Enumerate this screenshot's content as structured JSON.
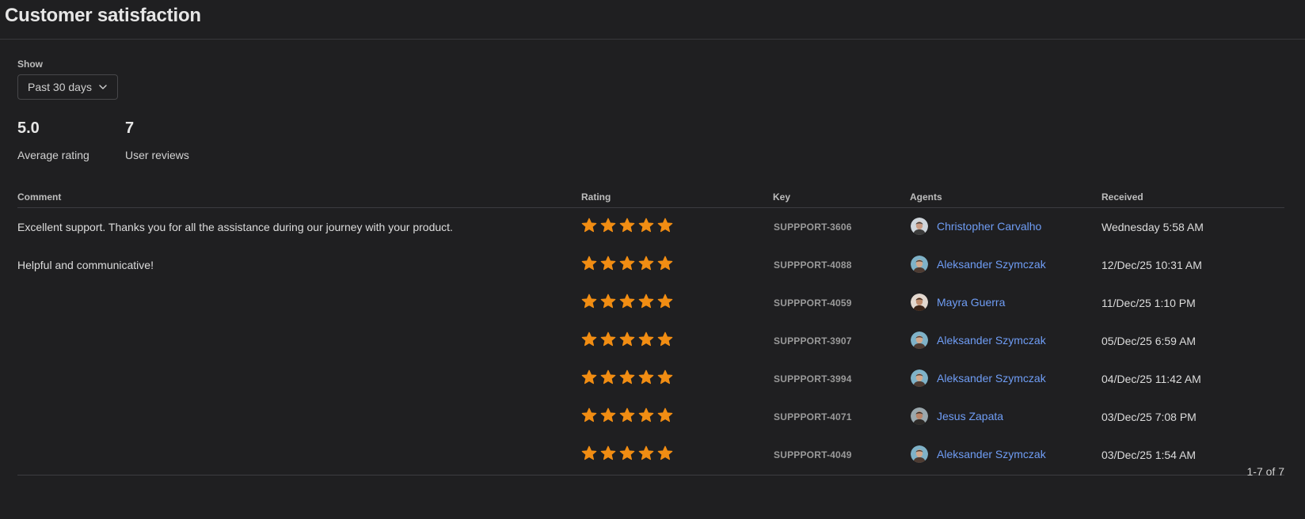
{
  "header": {
    "title": "Customer satisfaction"
  },
  "filter": {
    "label": "Show",
    "selected": "Past 30 days"
  },
  "metrics": {
    "average": {
      "value": "5.0",
      "label": "Average rating"
    },
    "reviews": {
      "value": "7",
      "label": "User reviews"
    }
  },
  "table": {
    "columns": [
      "Comment",
      "Rating",
      "Key",
      "Agents",
      "Received"
    ],
    "rows": [
      {
        "comment": "Excellent support. Thanks you for all the assistance during our journey with your product.",
        "rating": 5,
        "key": "SUPPPORT-3606",
        "agent": "Christopher Carvalho",
        "received": "Wednesday 5:58 AM"
      },
      {
        "comment": "Helpful and communicative!",
        "rating": 5,
        "key": "SUPPPORT-4088",
        "agent": "Aleksander Szymczak",
        "received": "12/Dec/25 10:31 AM"
      },
      {
        "comment": "",
        "rating": 5,
        "key": "SUPPPORT-4059",
        "agent": "Mayra Guerra",
        "received": "11/Dec/25 1:10 PM"
      },
      {
        "comment": "",
        "rating": 5,
        "key": "SUPPPORT-3907",
        "agent": "Aleksander Szymczak",
        "received": "05/Dec/25 6:59 AM"
      },
      {
        "comment": "",
        "rating": 5,
        "key": "SUPPPORT-3994",
        "agent": "Aleksander Szymczak",
        "received": "04/Dec/25 11:42 AM"
      },
      {
        "comment": "",
        "rating": 5,
        "key": "SUPPPORT-4071",
        "agent": "Jesus Zapata",
        "received": "03/Dec/25 7:08 PM"
      },
      {
        "comment": "",
        "rating": 5,
        "key": "SUPPPORT-4049",
        "agent": "Aleksander Szymczak",
        "received": "03/Dec/25 1:54 AM"
      }
    ]
  },
  "pagination": {
    "label": "1-7 of 7"
  },
  "colors": {
    "background": "#1f1f21",
    "star": "#f18d13",
    "link": "#6f9df5"
  },
  "icons": {
    "filter_caret": "chevron-down-icon",
    "rating": "star-icon",
    "agent": "avatar"
  }
}
